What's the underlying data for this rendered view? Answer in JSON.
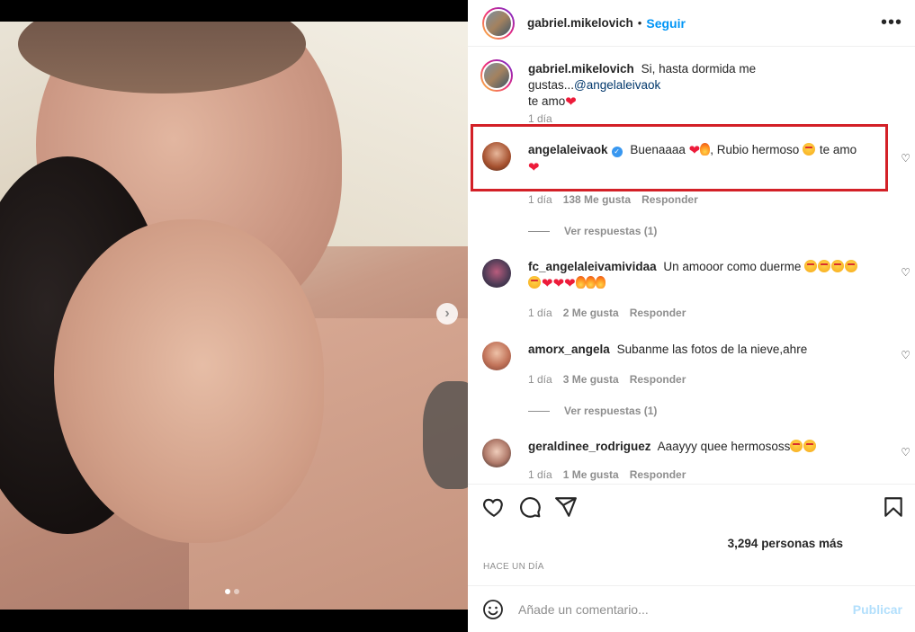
{
  "post": {
    "author": "gabriel.mikelovich",
    "separator": "•",
    "follow_label": "Seguir",
    "more_icon": "more-horizontal-icon",
    "caption_text": "Si, hasta dormida me gustas...",
    "caption_mention": "@angelaleivaok",
    "caption_suffix": "te amo",
    "caption_time": "1 día",
    "carousel": {
      "current": 1,
      "total": 2
    }
  },
  "comments": [
    {
      "username": "angelaleivaok",
      "verified": true,
      "text_a": "Buenaaaa",
      "text_b": ", Rubio hermoso",
      "text_c": "te amo",
      "time": "1 día",
      "likes": "138 Me gusta",
      "reply": "Responder",
      "view_replies": "Ver respuestas (1)"
    },
    {
      "username": "fc_angelaleivamividaa",
      "text_a": "Un amooor como duerme",
      "time": "1 día",
      "likes": "2 Me gusta",
      "reply": "Responder"
    },
    {
      "username": "amorx_angela",
      "text_a": "Subanme las fotos de la nieve,ahre",
      "time": "1 día",
      "likes": "3 Me gusta",
      "reply": "Responder",
      "view_replies": "Ver respuestas (1)"
    },
    {
      "username": "geraldinee_rodriguez",
      "text_a": "Aaayyy quee hermososs",
      "time": "1 día",
      "likes": "1 Me gusta",
      "reply": "Responder"
    }
  ],
  "footer": {
    "likes_text": "3,294 personas más",
    "timestamp": "HACE UN DÍA",
    "comment_placeholder": "Añade un comentario...",
    "publish_label": "Publicar"
  },
  "colors": {
    "accent": "#0095f6",
    "highlight": "#d32027",
    "publish_disabled": "#b2dffc",
    "heart": "#ed1b3a"
  }
}
